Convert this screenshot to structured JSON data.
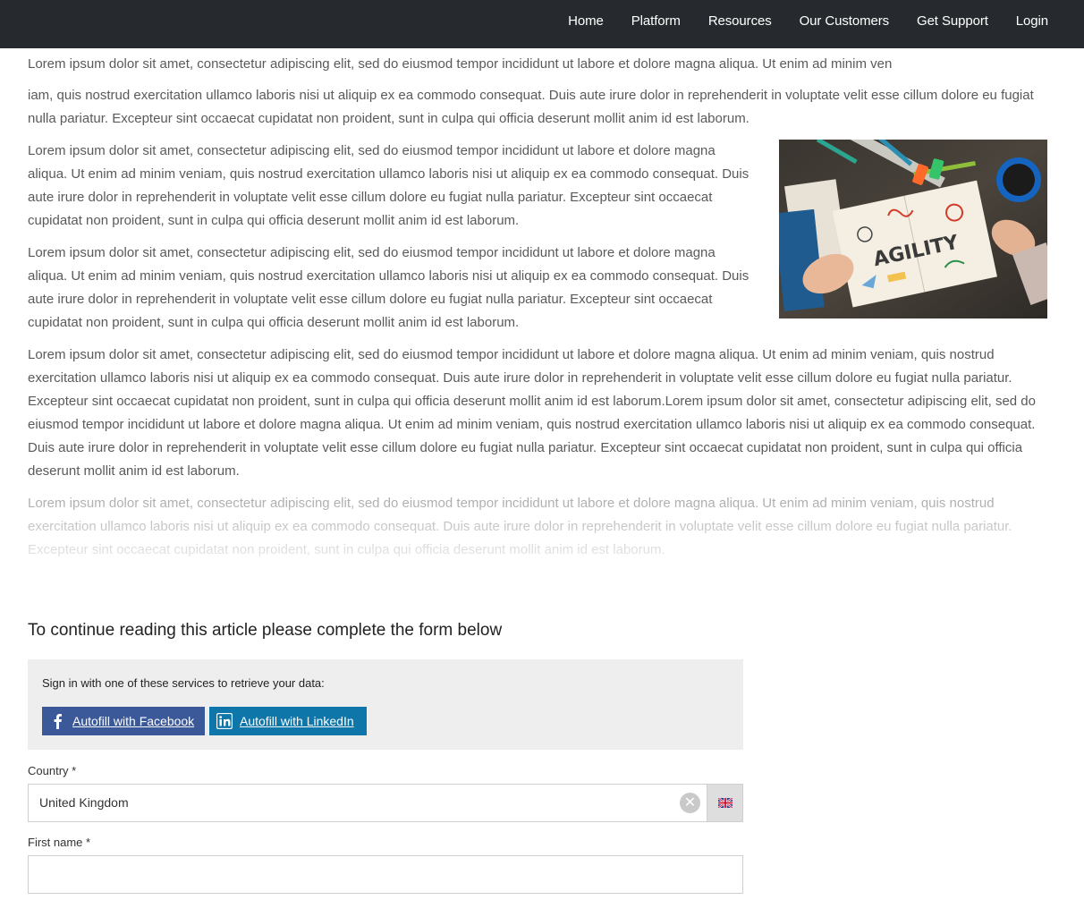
{
  "nav": {
    "items": [
      "Home",
      "Platform",
      "Resources",
      "Our Customers",
      "Get Support",
      "Login"
    ]
  },
  "article": {
    "p1": "Lorem ipsum dolor sit amet, consectetur adipiscing elit, sed do eiusmod tempor incididunt ut labore et dolore magna aliqua. Ut enim ad minim ven",
    "p2": "iam, quis nostrud exercitation ullamco laboris nisi ut aliquip ex ea commodo consequat. Duis aute irure dolor in reprehenderit in voluptate velit esse cillum dolore eu fugiat nulla pariatur. Excepteur sint occaecat cupidatat non proident, sunt in culpa qui officia deserunt mollit anim id est laborum.",
    "p3": "Lorem ipsum dolor sit amet, consectetur adipiscing elit, sed do eiusmod tempor incididunt ut labore et dolore magna aliqua. Ut enim ad minim veniam, quis nostrud exercitation ullamco laboris nisi ut aliquip ex ea commodo consequat. Duis aute irure dolor in reprehenderit in voluptate velit esse cillum dolore eu fugiat nulla pariatur. Excepteur sint occaecat cupidatat non proident, sunt in culpa qui officia deserunt mollit anim id est laborum.",
    "p4": "Lorem ipsum dolor sit amet, consectetur adipiscing elit, sed do eiusmod tempor incididunt ut labore et dolore magna aliqua. Ut enim ad minim veniam, quis nostrud exercitation ullamco laboris nisi ut aliquip ex ea commodo consequat. Duis aute irure dolor in reprehenderit in voluptate velit esse cillum dolore eu fugiat nulla pariatur. Excepteur sint occaecat cupidatat non proident, sunt in culpa qui officia deserunt mollit anim id est laborum.",
    "p5": "Lorem ipsum dolor sit amet, consectetur adipiscing elit, sed do eiusmod tempor incididunt ut labore et dolore magna aliqua. Ut enim ad minim veniam, quis nostrud exercitation ullamco laboris nisi ut aliquip ex ea commodo consequat. Duis aute irure dolor in reprehenderit in voluptate velit esse cillum dolore eu fugiat nulla pariatur. Excepteur sint occaecat cupidatat non proident, sunt in culpa qui officia deserunt mollit anim id est laborum.Lorem ipsum dolor sit amet, consectetur adipiscing elit, sed do eiusmod tempor incididunt ut labore et dolore magna aliqua. Ut enim ad minim veniam, quis nostrud exercitation ullamco laboris nisi ut aliquip ex ea commodo consequat. Duis aute irure dolor in reprehenderit in voluptate velit esse cillum dolore eu fugiat nulla pariatur. Excepteur sint occaecat cupidatat non proident, sunt in culpa qui officia deserunt mollit anim id est laborum.",
    "p6": "Lorem ipsum dolor sit amet, consectetur adipiscing elit, sed do eiusmod tempor incididunt ut labore et dolore magna aliqua. Ut enim ad minim veniam, quis nostrud exercitation ullamco laboris nisi ut aliquip ex ea commodo consequat. Duis aute irure dolor in reprehenderit in voluptate velit esse cillum dolore eu fugiat nulla pariatur. Excepteur sint occaecat cupidatat non proident, sunt in culpa qui officia deserunt mollit anim id est laborum.",
    "image": {
      "icon": "agility-notebook-image",
      "logo_text": "AGILITY"
    }
  },
  "gate": {
    "heading": "To continue reading this article please complete the form below",
    "autofill_prompt": "Sign in with one of these services to retrieve your data:",
    "facebook_label": "Autofill with Facebook",
    "linkedin_label": "Autofill with LinkedIn"
  },
  "form": {
    "country_label": "Country *",
    "country_value": "United Kingdom",
    "firstname_label": "First name *",
    "firstname_value": ""
  },
  "colors": {
    "navbar": "#262a2e",
    "facebook": "#3b5998",
    "linkedin": "#0e76a8",
    "autofill_bg": "#eeeeee"
  }
}
